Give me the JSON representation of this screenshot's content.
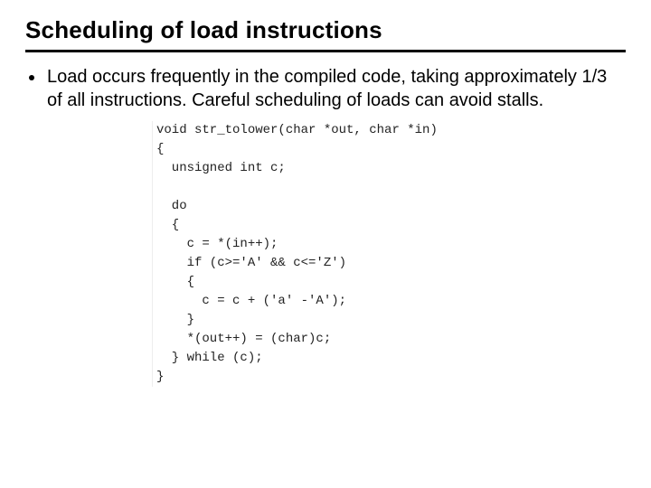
{
  "title": "Scheduling of load instructions",
  "bullet": "Load occurs frequently in the compiled code, taking approximately 1/3 of all instructions. Careful scheduling of loads can avoid stalls.",
  "code": "void str_tolower(char *out, char *in)\n{\n  unsigned int c;\n\n  do\n  {\n    c = *(in++);\n    if (c>='A' && c<='Z')\n    {\n      c = c + ('a' -'A');\n    }\n    *(out++) = (char)c;\n  } while (c);\n}"
}
